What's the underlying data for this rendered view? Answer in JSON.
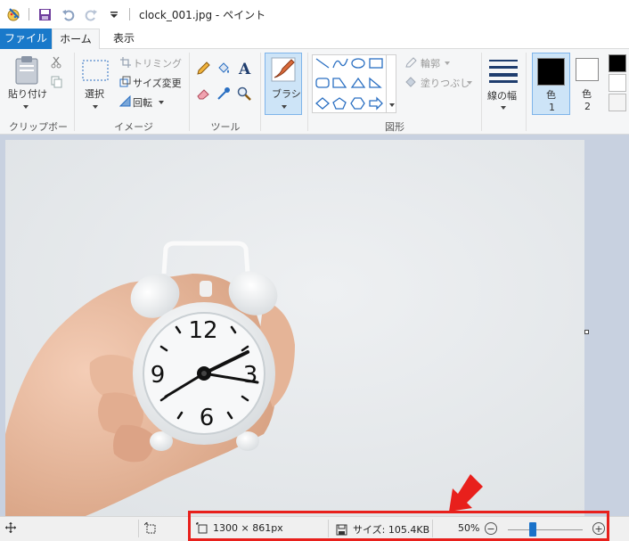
{
  "window": {
    "title": "clock_001.jpg - ペイント"
  },
  "tabs": [
    {
      "label": "ファイル"
    },
    {
      "label": "ホーム"
    },
    {
      "label": "表示"
    }
  ],
  "ribbon": {
    "clipboard": {
      "paste_label": "貼り付け",
      "group_label": "クリップボード"
    },
    "image": {
      "select_label": "選択",
      "crop_label": "トリミング",
      "resize_label": "サイズ変更",
      "rotate_label": "回転",
      "group_label": "イメージ"
    },
    "tools": {
      "group_label": "ツール"
    },
    "brushes": {
      "label": "ブラシ"
    },
    "shapes": {
      "outline_label": "輪郭",
      "fill_label": "塗りつぶし",
      "group_label": "図形"
    },
    "size": {
      "label": "線の幅"
    },
    "colors": {
      "color1_label": "色",
      "color1_number": "1",
      "color2_label": "色",
      "color2_number": "2",
      "color1": "#000000",
      "color2": "#ffffff"
    }
  },
  "status": {
    "dimensions": "1300 × 861px",
    "size_label": "サイズ: 105.4KB",
    "zoom": "50%",
    "zoom_level_fraction": 0.5
  },
  "colors": {
    "accent": "#1979ca",
    "highlight_box": "#e8201c",
    "arrow": "#e8201c",
    "workspace_bg": "#c8d1e0"
  }
}
